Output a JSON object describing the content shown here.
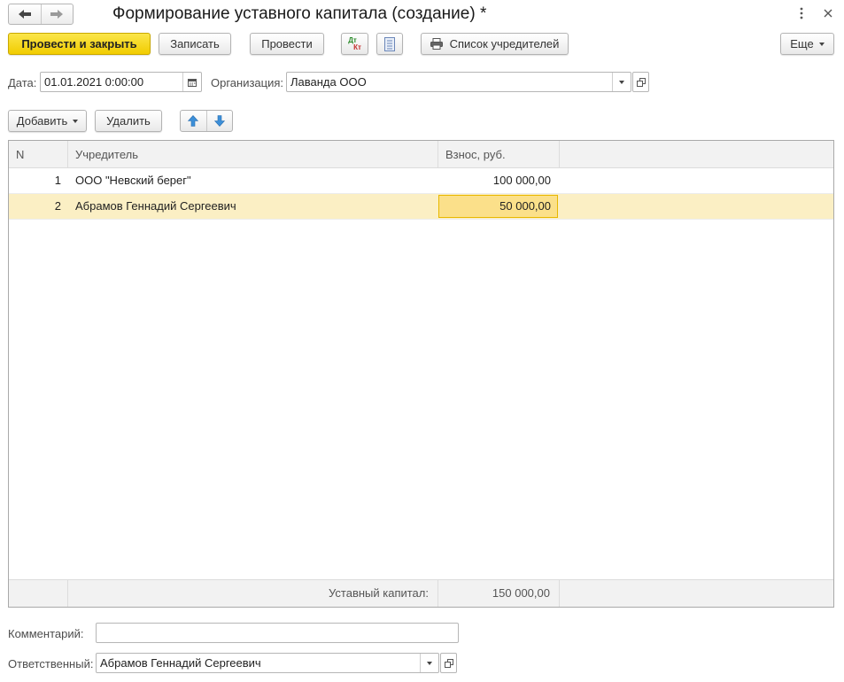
{
  "window": {
    "title": "Формирование уставного капитала (создание) *"
  },
  "toolbar": {
    "post_close": "Провести и закрыть",
    "save": "Записать",
    "post": "Провести",
    "dtkt_dt": "Дт",
    "dtkt_kt": "Кт",
    "founders_list": "Список учредителей",
    "more": "Еще"
  },
  "form": {
    "date_label": "Дата:",
    "date_value": "01.01.2021  0:00:00",
    "org_label": "Организация:",
    "org_value": "Лаванда ООО",
    "comment_label": "Комментарий:",
    "comment_value": "",
    "responsible_label": "Ответственный:",
    "responsible_value": "Абрамов Геннадий Сергеевич"
  },
  "table_toolbar": {
    "add": "Добавить",
    "delete": "Удалить"
  },
  "table": {
    "columns": [
      "N",
      "Учредитель",
      "Взнос, руб."
    ],
    "rows": [
      {
        "n": "1",
        "founder": "ООО \"Невский берег\"",
        "amount": "100 000,00"
      },
      {
        "n": "2",
        "founder": "Абрамов Геннадий Сергеевич",
        "amount": "50 000,00"
      }
    ],
    "footer_label": "Уставный капитал:",
    "footer_total": "150 000,00"
  },
  "colors": {
    "primary_button": "#f5d400",
    "selected_row": "#fbefc4",
    "focused_cell": "#fbe08a"
  }
}
